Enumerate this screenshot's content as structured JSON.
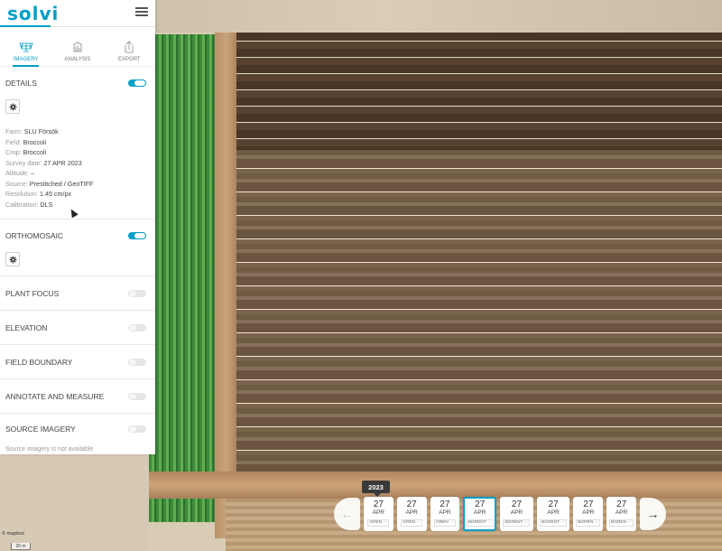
{
  "app": {
    "logo": "solvi"
  },
  "tabs": [
    {
      "label": "IMAGERY",
      "icon": "solar-panel-icon",
      "active": true
    },
    {
      "label": "ANALYSIS",
      "icon": "chart-icon",
      "active": false
    },
    {
      "label": "EXPORT",
      "icon": "export-icon",
      "active": false
    }
  ],
  "details": {
    "title": "DETAILS",
    "enabled": true,
    "rows": [
      {
        "key": "Farm:",
        "value": "SLU Försök"
      },
      {
        "key": "Field:",
        "value": "Broccoli"
      },
      {
        "key": "Crop:",
        "value": "Broccoli"
      },
      {
        "key": "Survey date:",
        "value": "27 APR 2023"
      },
      {
        "key": "Altitude:",
        "value": "–"
      },
      {
        "key": "Source:",
        "value": "Prestitched / GeoTIFF"
      },
      {
        "key": "Resolution:",
        "value": "1.45 cm/px"
      },
      {
        "key": "Calibration:",
        "value": "DLS"
      }
    ]
  },
  "orthomosaic": {
    "title": "ORTHOMOSAIC",
    "enabled": true
  },
  "layers": [
    {
      "title": "PLANT FOCUS",
      "enabled": false
    },
    {
      "title": "ELEVATION",
      "enabled": false
    },
    {
      "title": "FIELD BOUNDARY",
      "enabled": false
    },
    {
      "title": "ANNOTATE AND MEASURE",
      "enabled": false
    }
  ],
  "source_imagery": {
    "title": "SOURCE IMAGERY",
    "enabled": false,
    "note": "Source imagery is not available"
  },
  "timeline": {
    "year": "2023",
    "prev_icon": "←",
    "next_icon": "→",
    "dates": [
      {
        "day": "27",
        "month": "APR",
        "label": "GREN ···",
        "active": false
      },
      {
        "day": "27",
        "month": "APR",
        "label": "GREN ···",
        "active": false
      },
      {
        "day": "27",
        "month": "APR",
        "label": "GREN ···",
        "active": false
      },
      {
        "day": "27",
        "month": "APR",
        "label": "BGRENT ···",
        "active": true
      },
      {
        "day": "27",
        "month": "APR",
        "label": "BGRENT ···",
        "active": false
      },
      {
        "day": "27",
        "month": "APR",
        "label": "BGRENT ···",
        "active": false
      },
      {
        "day": "27",
        "month": "APR",
        "label": "BGREN ···",
        "active": false
      },
      {
        "day": "27",
        "month": "APR",
        "label": "BGREN ···",
        "active": false
      }
    ]
  },
  "map": {
    "scale_label": "20 m",
    "attribution": "© mapbox"
  }
}
